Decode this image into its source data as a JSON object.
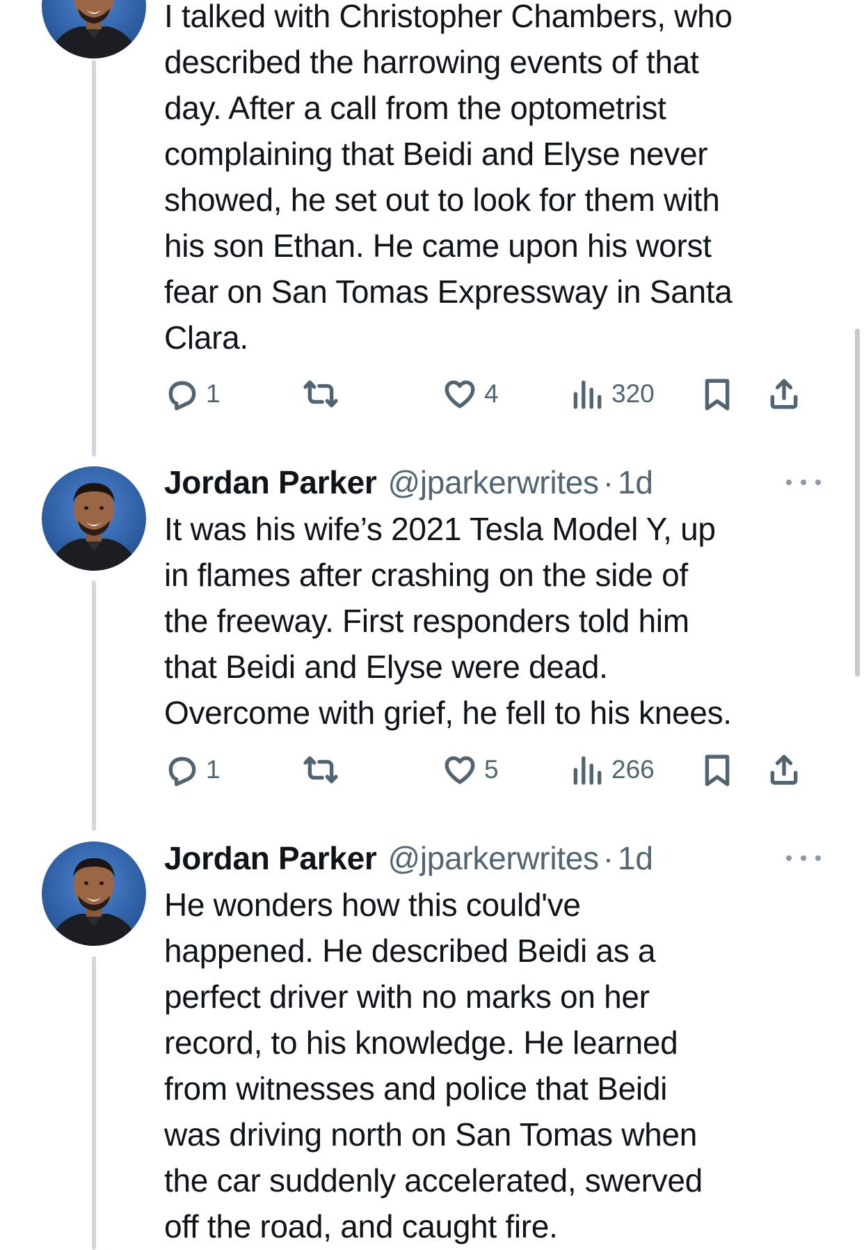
{
  "tweets": [
    {
      "text": "I talked with Christopher Chambers, who\ndescribed the harrowing events of that\nday. After a call from the optometrist\ncomplaining that Beidi and Elyse never\nshowed, he set out to look for them with\nhis son Ethan. He came upon his worst\nfear on San Tomas Expressway in Santa\nClara.",
      "replies": "1",
      "likes": "4",
      "views": "320"
    },
    {
      "author_name": "Jordan Parker",
      "handle": "@jparkerwrites",
      "separator": "·",
      "time": "1d",
      "text": "It was his wife’s 2021 Tesla Model Y, up\nin flames after crashing on the side of\nthe freeway. First responders told him\nthat Beidi and Elyse were dead.\nOvercome with grief, he fell to his knees.",
      "replies": "1",
      "likes": "5",
      "views": "266"
    },
    {
      "author_name": "Jordan Parker",
      "handle": "@jparkerwrites",
      "separator": "·",
      "time": "1d",
      "text": "He wonders how this could've\nhappened. He described Beidi as a\nperfect driver with no marks on her\nrecord, to his knowledge. He learned\nfrom witnesses and police that Beidi\nwas driving north on San Tomas when\nthe car suddenly accelerated, swerved\noff the road, and caught fire."
    }
  ],
  "icons": {
    "reply": "reply-icon",
    "retweet": "retweet-icon",
    "like": "heart-icon",
    "views": "views-icon",
    "bookmark": "bookmark-icon",
    "share": "share-icon",
    "more": "more-icon"
  },
  "colors": {
    "text": "#0f1419",
    "secondary": "#536471",
    "thread_line": "#cfd9de",
    "avatar_bg": "#2d5ea8"
  }
}
